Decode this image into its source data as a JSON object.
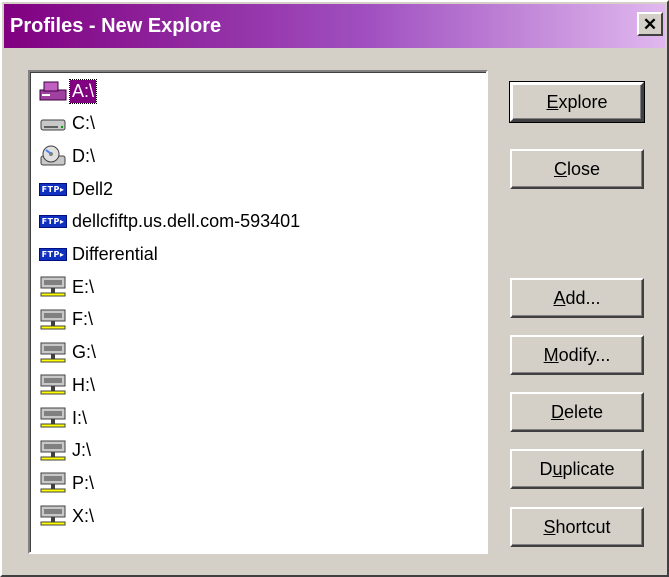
{
  "window": {
    "title": "Profiles - New Explore",
    "close_glyph": "✕"
  },
  "profiles": [
    {
      "label": "A:\\",
      "icon": "floppy-drive-icon",
      "selected": true
    },
    {
      "label": "C:\\",
      "icon": "hard-drive-icon"
    },
    {
      "label": "D:\\",
      "icon": "cd-drive-icon"
    },
    {
      "label": "Dell2",
      "icon": "ftp-icon"
    },
    {
      "label": "dellcfiftp.us.dell.com-593401",
      "icon": "ftp-icon"
    },
    {
      "label": "Differential",
      "icon": "ftp-icon"
    },
    {
      "label": "E:\\",
      "icon": "network-drive-icon"
    },
    {
      "label": "F:\\",
      "icon": "network-drive-icon"
    },
    {
      "label": "G:\\",
      "icon": "network-drive-icon"
    },
    {
      "label": "H:\\",
      "icon": "network-drive-icon"
    },
    {
      "label": "I:\\",
      "icon": "network-drive-icon"
    },
    {
      "label": "J:\\",
      "icon": "network-drive-icon"
    },
    {
      "label": "P:\\",
      "icon": "network-drive-icon"
    },
    {
      "label": "X:\\",
      "icon": "network-drive-icon"
    }
  ],
  "ftp_badge_text": "FTP",
  "buttons": {
    "explore": {
      "accel": "E",
      "rest": "xplore"
    },
    "close": {
      "accel": "C",
      "rest": "lose"
    },
    "add": {
      "accel": "A",
      "rest": "dd..."
    },
    "modify": {
      "accel": "M",
      "rest": "odify..."
    },
    "delete": {
      "accel": "D",
      "rest": "elete"
    },
    "duplicate": {
      "pre": "D",
      "accel": "u",
      "rest": "plicate"
    },
    "shortcut": {
      "accel": "S",
      "rest": "hortcut"
    }
  },
  "colors": {
    "selection": "#800080",
    "titlebar_start": "#800080",
    "face": "#d4d0c8"
  }
}
